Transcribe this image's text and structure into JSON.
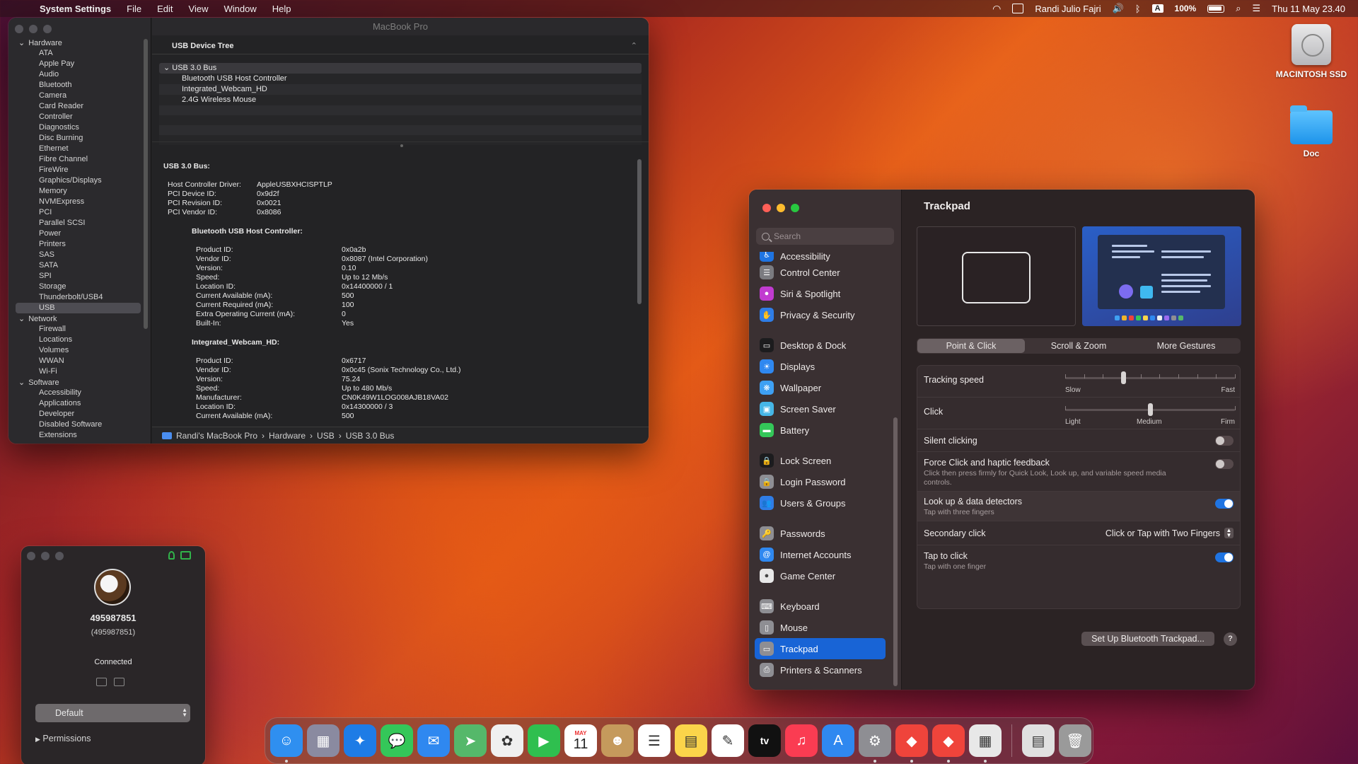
{
  "menubar": {
    "apple_glyph": "",
    "app_name": "System Settings",
    "menus": [
      "File",
      "Edit",
      "View",
      "Window",
      "Help"
    ],
    "user": "Randi Julio Fajri",
    "input_badge": "A",
    "battery": "100%",
    "datetime": "Thu 11 May  23.40"
  },
  "desktop": {
    "disk_label": "MACINTOSH SSD",
    "folder_label": "Doc"
  },
  "sysinfo": {
    "title": "MacBook Pro",
    "sidebar": {
      "hardware_label": "Hardware",
      "hardware_items": [
        "ATA",
        "Apple Pay",
        "Audio",
        "Bluetooth",
        "Camera",
        "Card Reader",
        "Controller",
        "Diagnostics",
        "Disc Burning",
        "Ethernet",
        "Fibre Channel",
        "FireWire",
        "Graphics/Displays",
        "Memory",
        "NVMExpress",
        "PCI",
        "Parallel SCSI",
        "Power",
        "Printers",
        "SAS",
        "SATA",
        "SPI",
        "Storage",
        "Thunderbolt/USB4",
        "USB"
      ],
      "network_label": "Network",
      "network_items": [
        "Firewall",
        "Locations",
        "Volumes",
        "WWAN",
        "Wi-Fi"
      ],
      "software_label": "Software",
      "software_items": [
        "Accessibility",
        "Applications",
        "Developer",
        "Disabled Software",
        "Extensions"
      ]
    },
    "tree_header": "USB Device Tree",
    "tree_bus": "USB 3.0 Bus",
    "tree_children": [
      "Bluetooth USB Host Controller",
      "Integrated_Webcam_HD",
      "2.4G Wireless Mouse"
    ],
    "detail": {
      "bus_title": "USB 3.0 Bus:",
      "bus_props": [
        {
          "k": "Host Controller Driver:",
          "v": "AppleUSBXHCISPTLP"
        },
        {
          "k": "PCI Device ID:",
          "v": "0x9d2f"
        },
        {
          "k": "PCI Revision ID:",
          "v": "0x0021"
        },
        {
          "k": "PCI Vendor ID:",
          "v": "0x8086"
        }
      ],
      "bt_title": "Bluetooth USB Host Controller:",
      "bt_props": [
        {
          "k": "Product ID:",
          "v": "0x0a2b"
        },
        {
          "k": "Vendor ID:",
          "v": "0x8087  (Intel Corporation)"
        },
        {
          "k": "Version:",
          "v": "0.10"
        },
        {
          "k": "Speed:",
          "v": "Up to 12 Mb/s"
        },
        {
          "k": "Location ID:",
          "v": "0x14400000 / 1"
        },
        {
          "k": "Current Available (mA):",
          "v": "500"
        },
        {
          "k": "Current Required (mA):",
          "v": "100"
        },
        {
          "k": "Extra Operating Current (mA):",
          "v": "0"
        },
        {
          "k": "Built-In:",
          "v": "Yes"
        }
      ],
      "cam_title": "Integrated_Webcam_HD:",
      "cam_props": [
        {
          "k": "Product ID:",
          "v": "0x6717"
        },
        {
          "k": "Vendor ID:",
          "v": "0x0c45  (Sonix Technology Co., Ltd.)"
        },
        {
          "k": "Version:",
          "v": "75.24"
        },
        {
          "k": "Speed:",
          "v": "Up to 480 Mb/s"
        },
        {
          "k": "Manufacturer:",
          "v": "CN0K49W1LOG008AJB18VA02"
        },
        {
          "k": "Location ID:",
          "v": "0x14300000 / 3"
        },
        {
          "k": "Current Available (mA):",
          "v": "500"
        }
      ]
    },
    "pathbar": [
      "Randi's MacBook Pro",
      "Hardware",
      "USB",
      "USB 3.0 Bus"
    ],
    "path_sep": "›"
  },
  "settings": {
    "search_placeholder": "Search",
    "nav": [
      {
        "label": "Accessibility",
        "color": "#1f74e2",
        "glyph": "♿",
        "clip": true
      },
      {
        "label": "Control Center",
        "color": "#7b7b80",
        "glyph": "☰"
      },
      {
        "label": "Siri & Spotlight",
        "color": "#c13bd0",
        "glyph": "●"
      },
      {
        "label": "Privacy & Security",
        "color": "#2f7de6",
        "glyph": "✋"
      },
      {
        "label": "Desktop & Dock",
        "color": "#1c1c1e",
        "glyph": "▭",
        "gap": true
      },
      {
        "label": "Displays",
        "color": "#2f88f0",
        "glyph": "☀"
      },
      {
        "label": "Wallpaper",
        "color": "#3ea0f3",
        "glyph": "❋"
      },
      {
        "label": "Screen Saver",
        "color": "#46b6e6",
        "glyph": "▣"
      },
      {
        "label": "Battery",
        "color": "#34c759",
        "glyph": "▬"
      },
      {
        "label": "Lock Screen",
        "color": "#1c1c1e",
        "glyph": "🔒",
        "gap": true
      },
      {
        "label": "Login Password",
        "color": "#8e8e93",
        "glyph": "🔒"
      },
      {
        "label": "Users & Groups",
        "color": "#2f7de6",
        "glyph": "👥"
      },
      {
        "label": "Passwords",
        "color": "#8e8e93",
        "glyph": "🔑",
        "gap": true
      },
      {
        "label": "Internet Accounts",
        "color": "#2f88f0",
        "glyph": "@"
      },
      {
        "label": "Game Center",
        "color": "#e8e8e8",
        "glyph": "●"
      },
      {
        "label": "Keyboard",
        "color": "#8e8e93",
        "glyph": "⌨",
        "gap": true
      },
      {
        "label": "Mouse",
        "color": "#8e8e93",
        "glyph": "▯"
      },
      {
        "label": "Trackpad",
        "color": "#8e8e93",
        "glyph": "▭",
        "active": true
      },
      {
        "label": "Printers & Scanners",
        "color": "#8e8e93",
        "glyph": "⎙"
      }
    ],
    "pane_title": "Trackpad",
    "tabs": [
      {
        "label": "Point & Click",
        "on": true
      },
      {
        "label": "Scroll & Zoom",
        "on": false
      },
      {
        "label": "More Gestures",
        "on": false
      }
    ],
    "tracking": {
      "label": "Tracking speed",
      "min_label": "Slow",
      "max_label": "Fast",
      "value": 0.34
    },
    "click": {
      "label": "Click",
      "labels": [
        "Light",
        "Medium",
        "Firm"
      ],
      "value": 0.5
    },
    "silent_clicking": {
      "label": "Silent clicking",
      "on": false
    },
    "force_click": {
      "label": "Force Click and haptic feedback",
      "sub": "Click then press firmly for Quick Look, Look up, and variable speed media controls.",
      "on": false
    },
    "lookup": {
      "label": "Look up & data detectors",
      "sub": "Tap with three fingers",
      "on": true
    },
    "secondary_click": {
      "label": "Secondary click",
      "value": "Click or Tap with Two Fingers"
    },
    "tap_to_click": {
      "label": "Tap to click",
      "sub": "Tap with one finger",
      "on": true
    },
    "bt_button": "Set Up Bluetooth Trackpad...",
    "help": "?"
  },
  "connection": {
    "name": "495987851",
    "id": "(495987851)",
    "status": "Connected",
    "profile": "Default",
    "permissions": "Permissions",
    "permissions_arrow": "▶"
  },
  "dock": {
    "calendar_month": "MAY",
    "calendar_day": "11",
    "tv_label": "tv",
    "apps": [
      {
        "name": "finder",
        "color": "#2f8ff0",
        "glyph": "☺",
        "running": true
      },
      {
        "name": "launchpad",
        "color": "#8a8aa0",
        "glyph": "▦"
      },
      {
        "name": "safari",
        "color": "#1e7ce6",
        "glyph": "✦"
      },
      {
        "name": "messages",
        "color": "#34c759",
        "glyph": "💬"
      },
      {
        "name": "mail",
        "color": "#2f88f0",
        "glyph": "✉"
      },
      {
        "name": "maps",
        "color": "#55b86a",
        "glyph": "➤"
      },
      {
        "name": "photos",
        "color": "#f0f0f0",
        "glyph": "✿"
      },
      {
        "name": "facetime",
        "color": "#2fbf4f",
        "glyph": "▶"
      },
      {
        "name": "calendar",
        "color": "#ffffff",
        "glyph": ""
      },
      {
        "name": "contacts",
        "color": "#c59a5c",
        "glyph": "☻"
      },
      {
        "name": "reminders",
        "color": "#ffffff",
        "glyph": "☰"
      },
      {
        "name": "notes",
        "color": "#fbd44a",
        "glyph": "▤"
      },
      {
        "name": "freeform",
        "color": "#ffffff",
        "glyph": "✎"
      },
      {
        "name": "apple-tv",
        "color": "#111111",
        "glyph": ""
      },
      {
        "name": "music",
        "color": "#fa3c52",
        "glyph": "♫"
      },
      {
        "name": "app-store",
        "color": "#2f88f0",
        "glyph": "A"
      },
      {
        "name": "system-settings",
        "color": "#8e8e93",
        "glyph": "⚙",
        "running": true
      },
      {
        "name": "anydesk",
        "color": "#ef443b",
        "glyph": "◆",
        "running": true
      },
      {
        "name": "anydesk-2",
        "color": "#ef443b",
        "glyph": "◆",
        "running": true
      },
      {
        "name": "system-information",
        "color": "#e8e8e8",
        "glyph": "▦",
        "running": true
      }
    ],
    "extras": [
      {
        "name": "downloads",
        "color": "#e0e0e0",
        "glyph": "▤"
      },
      {
        "name": "trash",
        "color": "#9a9a9a",
        "glyph": "🗑"
      }
    ]
  }
}
